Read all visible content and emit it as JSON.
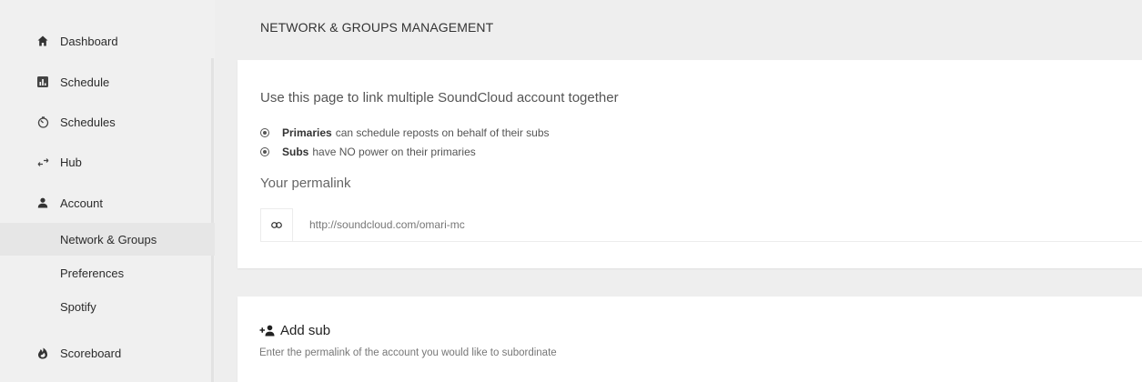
{
  "sidebar": {
    "items": [
      {
        "label": "Dashboard",
        "icon": "home-icon"
      },
      {
        "label": "Schedule",
        "icon": "bar-chart-icon"
      },
      {
        "label": "Schedules",
        "icon": "timer-icon"
      },
      {
        "label": "Hub",
        "icon": "swap-arrows-icon"
      },
      {
        "label": "Account",
        "icon": "person-icon"
      }
    ],
    "subitems": [
      {
        "label": "Network & Groups",
        "active": true
      },
      {
        "label": "Preferences",
        "active": false
      },
      {
        "label": "Spotify",
        "active": false
      }
    ],
    "scoreboard": {
      "label": "Scoreboard",
      "icon": "flame-icon"
    }
  },
  "header": {
    "title": "NETWORK & GROUPS MANAGEMENT"
  },
  "network_card": {
    "intro": "Use this page to link multiple SoundCloud account together",
    "bullets": [
      {
        "strong": "Primaries",
        "text": "can schedule reposts on behalf of their subs"
      },
      {
        "strong": "Subs",
        "text": "have NO power on their primaries"
      }
    ],
    "permalink_label": "Your permalink",
    "permalink_value": "http://soundcloud.com/omari-mc",
    "permalink_icon": "link-icon"
  },
  "add_sub_card": {
    "title": "Add sub",
    "icon": "add-person-icon",
    "description": "Enter the permalink of the account you would like to subordinate"
  }
}
